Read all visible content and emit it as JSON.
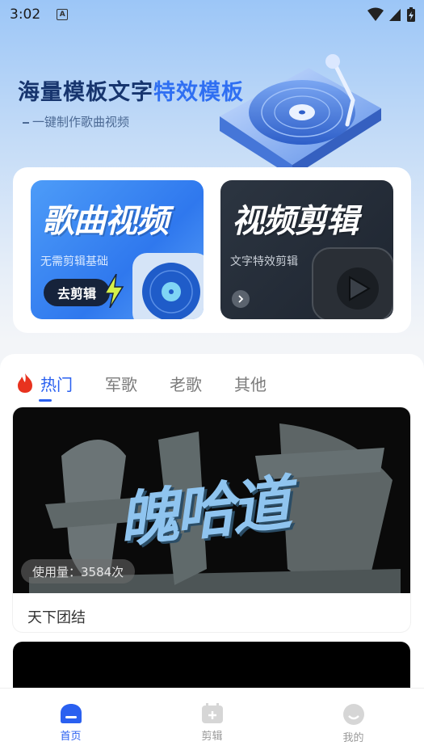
{
  "status_bar": {
    "time": "3:02",
    "a_icon": "A"
  },
  "hero": {
    "title_main": "海量模板文字",
    "title_accent": "特效模板",
    "subtitle": "一键制作歌曲视频"
  },
  "entries": [
    {
      "title": "歌曲视频",
      "subtitle": "无需剪辑基础",
      "button": "去剪辑"
    },
    {
      "title": "视频剪辑",
      "subtitle": "文字特效剪辑"
    }
  ],
  "tabs": [
    {
      "label": "热门",
      "active": true
    },
    {
      "label": "军歌",
      "active": false
    },
    {
      "label": "老歌",
      "active": false
    },
    {
      "label": "其他",
      "active": false
    }
  ],
  "videos": [
    {
      "art_text": "魄哈道",
      "usage": "使用量：3584次",
      "title": "天下团结"
    }
  ],
  "bottom_nav": [
    {
      "label": "首页",
      "icon": "home-icon",
      "active": true
    },
    {
      "label": "剪辑",
      "icon": "edit-icon",
      "active": false
    },
    {
      "label": "我的",
      "icon": "profile-icon",
      "active": false
    }
  ],
  "colors": {
    "accent": "#2a60f0",
    "hero_title": "#17356e",
    "tile_blue": "#2f78ee",
    "tile_dark": "#1e2530"
  }
}
